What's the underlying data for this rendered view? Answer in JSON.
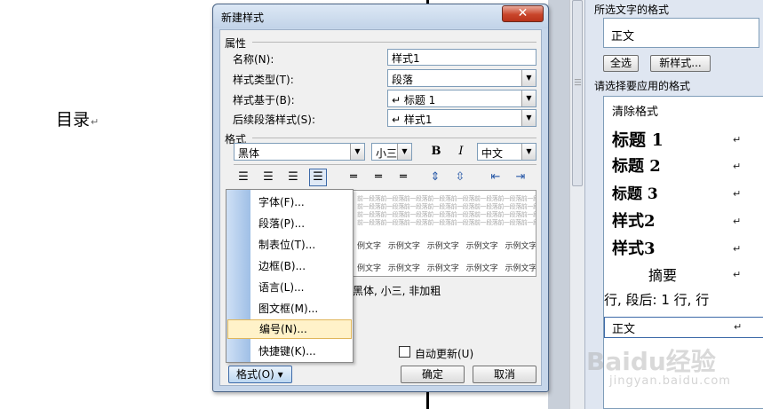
{
  "document": {
    "heading": "目录",
    "pilcrow": "↵"
  },
  "dialog": {
    "title": "新建样式",
    "close_glyph": "✕",
    "section_properties": "属性",
    "name_label": "名称(N):",
    "name_value": "样式1",
    "style_type_label": "样式类型(T):",
    "style_type_value": "段落",
    "based_on_label": "样式基于(B):",
    "based_on_value": "↵ 标题 1",
    "following_label": "后续段落样式(S):",
    "following_value": "↵ 样式1",
    "section_format": "格式",
    "font_value": "黑体",
    "size_value": "小三",
    "bold_glyph": "B",
    "italic_glyph": "I",
    "lang_value": "中文",
    "preview_filler": "前一段落前一段落前一段落前一段落前一段落前一段落前一段落前一段落前一段落前一段落",
    "preview_sample": "例文字 示例文字 示例文字 示例文字 示例文字",
    "description": "黑体, 小三, 非加粗",
    "auto_update_label": "自动更新(U)",
    "ok_label": "确定",
    "cancel_label": "取消",
    "format_button_label": "格式(O) ▾"
  },
  "format_menu": {
    "items": [
      "字体(F)...",
      "段落(P)...",
      "制表位(T)...",
      "边框(B)...",
      "语言(L)...",
      "图文框(M)...",
      "编号(N)...",
      "快捷键(K)..."
    ],
    "highlighted_index": 6
  },
  "task_pane": {
    "selected_format_label": "所选文字的格式",
    "selected_format_value": "正文",
    "select_all_label": "全选",
    "new_style_label": "新样式...",
    "apply_label": "请选择要应用的格式",
    "styles": [
      "清除格式",
      "标题 1",
      "标题 2",
      "标题 3",
      "样式2",
      "样式3",
      "摘要",
      "行, 段后: 1 行, 行",
      "正文"
    ]
  },
  "watermark": {
    "brand": "Baidu经验",
    "url": "jingyan.baidu.com"
  }
}
